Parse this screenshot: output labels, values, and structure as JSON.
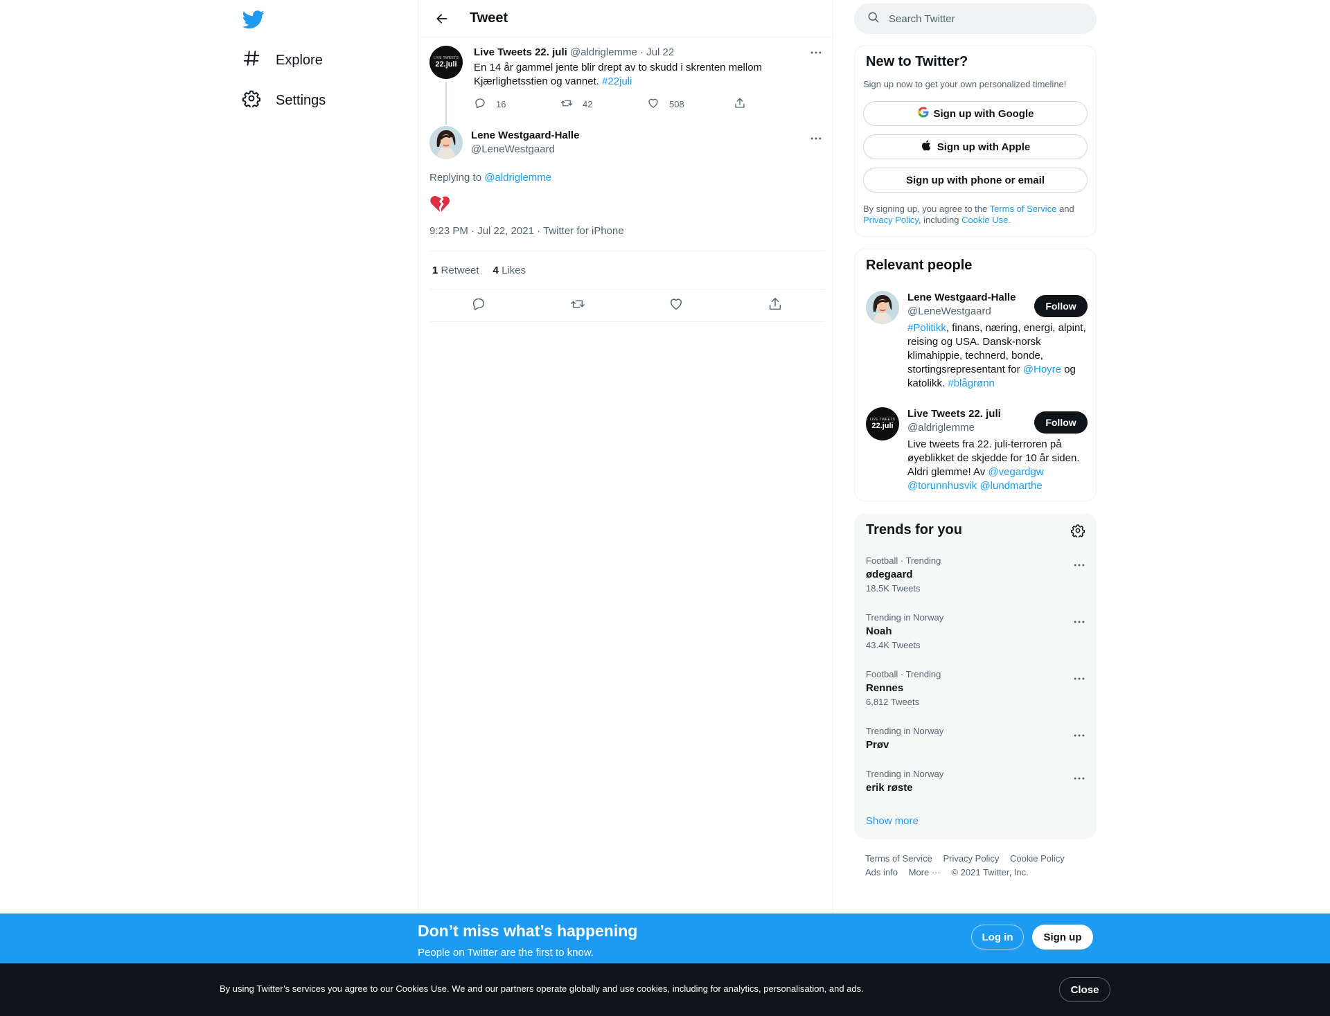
{
  "nav": {
    "logo": "twitter-bird",
    "items": [
      {
        "label": "Explore",
        "icon": "hashtag-icon"
      },
      {
        "label": "Settings",
        "icon": "gear-icon"
      }
    ]
  },
  "header": {
    "title": "Tweet"
  },
  "parent_tweet": {
    "name": "Live Tweets 22. juli",
    "handle": "@aldriglemme",
    "time": "· Jul 22",
    "avatar_small": "LIVE TWEETS",
    "avatar_big": "22.juli",
    "text": "En 14 år gammel jente blir drept av to skudd i skrenten mellom Kjærlighetsstien og vannet.",
    "hashtag": "#22juli",
    "replies": "16",
    "retweets": "42",
    "likes": "508"
  },
  "main_tweet": {
    "name": "Lene Westgaard-Halle",
    "handle": "@LeneWestgaard",
    "replying_prefix": "Replying to",
    "replying_to": "@aldriglemme",
    "emoji": "broken-heart",
    "meta": "9:23 PM · Jul 22, 2021 · Twitter for iPhone",
    "retweet_count": "1",
    "retweet_label": "Retweet",
    "like_count": "4",
    "like_label": "Likes"
  },
  "search": {
    "placeholder": "Search Twitter"
  },
  "new_to_twitter": {
    "title": "New to Twitter?",
    "subtitle": "Sign up now to get your own personalized timeline!",
    "google": "Sign up with Google",
    "apple": "Sign up with Apple",
    "phone": "Sign up with phone or email",
    "legal_1": "By signing up, you agree to the",
    "tos": "Terms of Service",
    "legal_and": "and",
    "privacy": "Privacy Policy",
    "legal_including": ", including",
    "cookie": "Cookie Use."
  },
  "relevant": {
    "title": "Relevant people",
    "people": [
      {
        "name": "Lene Westgaard-Halle",
        "handle": "@LeneWestgaard",
        "bio_1": "#Politikk",
        "bio_2": ", finans, næring, energi, alpint, reising og USA. Dansk-norsk klimahippie, technerd, bonde, stortingsrepresentant for",
        "bio_3": "@Hoyre",
        "bio_4": "og katolikk.",
        "bio_5": "#blågrønn",
        "follow": "Follow"
      },
      {
        "name": "Live Tweets 22. juli",
        "handle": "@aldriglemme",
        "bio_1": "Live tweets fra 22. juli-terroren på øyeblikket de skjedde for 10 år siden. Aldri glemme! Av",
        "bio_2": "@vegardgw",
        "bio_3": "@torunnhusvik",
        "bio_4": "@lundmarthe",
        "follow": "Follow"
      }
    ]
  },
  "trends": {
    "title": "Trends for you",
    "items": [
      {
        "meta": "Football · Trending",
        "name": "ødegaard",
        "count": "18.5K Tweets"
      },
      {
        "meta": "Trending in Norway",
        "name": "Noah",
        "count": "43.4K Tweets"
      },
      {
        "meta": "Football · Trending",
        "name": "Rennes",
        "count": "6,812 Tweets"
      },
      {
        "meta": "Trending in Norway",
        "name": "Prøv",
        "count": ""
      },
      {
        "meta": "Trending in Norway",
        "name": "erik røste",
        "count": ""
      }
    ],
    "show_more": "Show more"
  },
  "footer": {
    "links": [
      "Terms of Service",
      "Privacy Policy",
      "Cookie Policy",
      "Ads info",
      "More ···"
    ],
    "copyright": "© 2021 Twitter, Inc."
  },
  "banner": {
    "headline": "Don’t miss what’s happening",
    "sub": "People on Twitter are the first to know.",
    "login": "Log in",
    "signup": "Sign up"
  },
  "cookie_bar": {
    "text": "By using Twitter’s services you agree to our Cookies Use. We and our partners operate globally and use cookies, including for analytics, personalisation, and ads.",
    "close": "Close"
  },
  "colors": {
    "accent": "#1d9bf0",
    "text": "#0f1419",
    "secondary": "#536471",
    "heart_red": "#dd2e44"
  }
}
